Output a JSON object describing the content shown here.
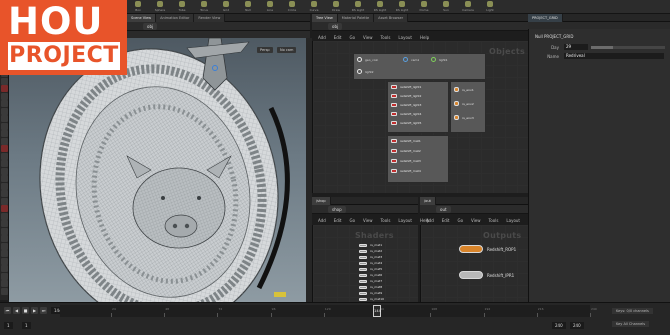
{
  "shelf": {
    "tools": [
      {
        "label": "Box",
        "icon": "box-icon"
      },
      {
        "label": "Sphere",
        "icon": "sphere-icon"
      },
      {
        "label": "Tube",
        "icon": "tube-icon"
      },
      {
        "label": "Torus",
        "icon": "torus-icon"
      },
      {
        "label": "Grid",
        "icon": "grid-icon"
      },
      {
        "label": "Null",
        "icon": "null-icon"
      },
      {
        "label": "Line",
        "icon": "line-icon"
      },
      {
        "label": "Circle",
        "icon": "circle-icon"
      },
      {
        "label": "Curve",
        "icon": "curve-icon"
      },
      {
        "label": "Draw",
        "icon": "draw-icon"
      },
      {
        "label": "RS Light",
        "icon": "light-icon"
      },
      {
        "label": "RS Light",
        "icon": "light-icon"
      },
      {
        "label": "RS Light",
        "icon": "light-icon"
      },
      {
        "label": "Dome",
        "icon": "dome-icon"
      },
      {
        "label": "Sun",
        "icon": "sun-icon"
      },
      {
        "label": "Camera",
        "icon": "camera-icon"
      },
      {
        "label": "Light",
        "icon": "light-icon"
      }
    ]
  },
  "viewport": {
    "tabs": [
      "Scene View",
      "Animation Editor",
      "Render View"
    ],
    "path": "obj",
    "controls": [
      "Persp",
      "No cam"
    ]
  },
  "network_top": {
    "tabs": [
      "Tree View",
      "Material Palette",
      "Asset Browser"
    ],
    "path": "obj",
    "menu": [
      "Add",
      "Edit",
      "Go",
      "View",
      "Tools",
      "Layout",
      "Help"
    ],
    "title": "Objects",
    "object_nodes": [
      "geo_coin",
      "cam1",
      "light1",
      "light2"
    ],
    "lights": [
      "redshift_light1",
      "redshift_light2",
      "redshift_light3",
      "redshift_light4",
      "redshift_light5"
    ],
    "shader_nodes": [
      "redshift_mat1",
      "redshift_mat2",
      "redshift_mat3",
      "redshift_mat4"
    ],
    "env_nodes": [
      "rs_env1",
      "rs_env2",
      "rs_env3"
    ]
  },
  "shop_pane": {
    "tabs": [
      "/shop"
    ],
    "path": "shop",
    "menu": [
      "Add",
      "Edit",
      "Go",
      "View",
      "Tools",
      "Layout",
      "Help"
    ],
    "title": "Shaders",
    "items": [
      "rs_mat1",
      "rs_mat2",
      "rs_mat3",
      "rs_mat4",
      "rs_mat5",
      "rs_mat6",
      "rs_mat7",
      "rs_mat8",
      "rs_mat9",
      "rs_mat10"
    ]
  },
  "out_pane": {
    "tabs": [
      "/out"
    ],
    "path": "out",
    "menu": [
      "Add",
      "Edit",
      "Go",
      "View",
      "Tools",
      "Layout",
      "Help"
    ],
    "title": "Outputs",
    "rops": [
      {
        "label": "Redshift_ROP1",
        "color": "#d8842a"
      },
      {
        "label": "Redshift_IPR1",
        "color": "#b8b8b8"
      }
    ]
  },
  "parm_pane": {
    "tabs": [
      "PROJECT_GRID"
    ],
    "header": "Null PROJECT_GRID",
    "rows": [
      {
        "label": "Day",
        "value": "29",
        "fill": 0.3
      },
      {
        "label": "Name",
        "value": "Redriveal"
      }
    ]
  },
  "timeline": {
    "frame": "144",
    "start": "1",
    "end": "240",
    "current": "144",
    "ticks": [
      "24",
      "48",
      "72",
      "96",
      "120",
      "144",
      "168",
      "192",
      "216",
      "240"
    ],
    "right_info": [
      "Keys: 0/0 channels",
      "Key All Channels"
    ]
  },
  "logo": {
    "line1": "HOU",
    "line2": "PROJECT"
  },
  "colors": {
    "accent": "#e8542a",
    "node_red": "#c23030",
    "node_orange": "#d8842a"
  }
}
